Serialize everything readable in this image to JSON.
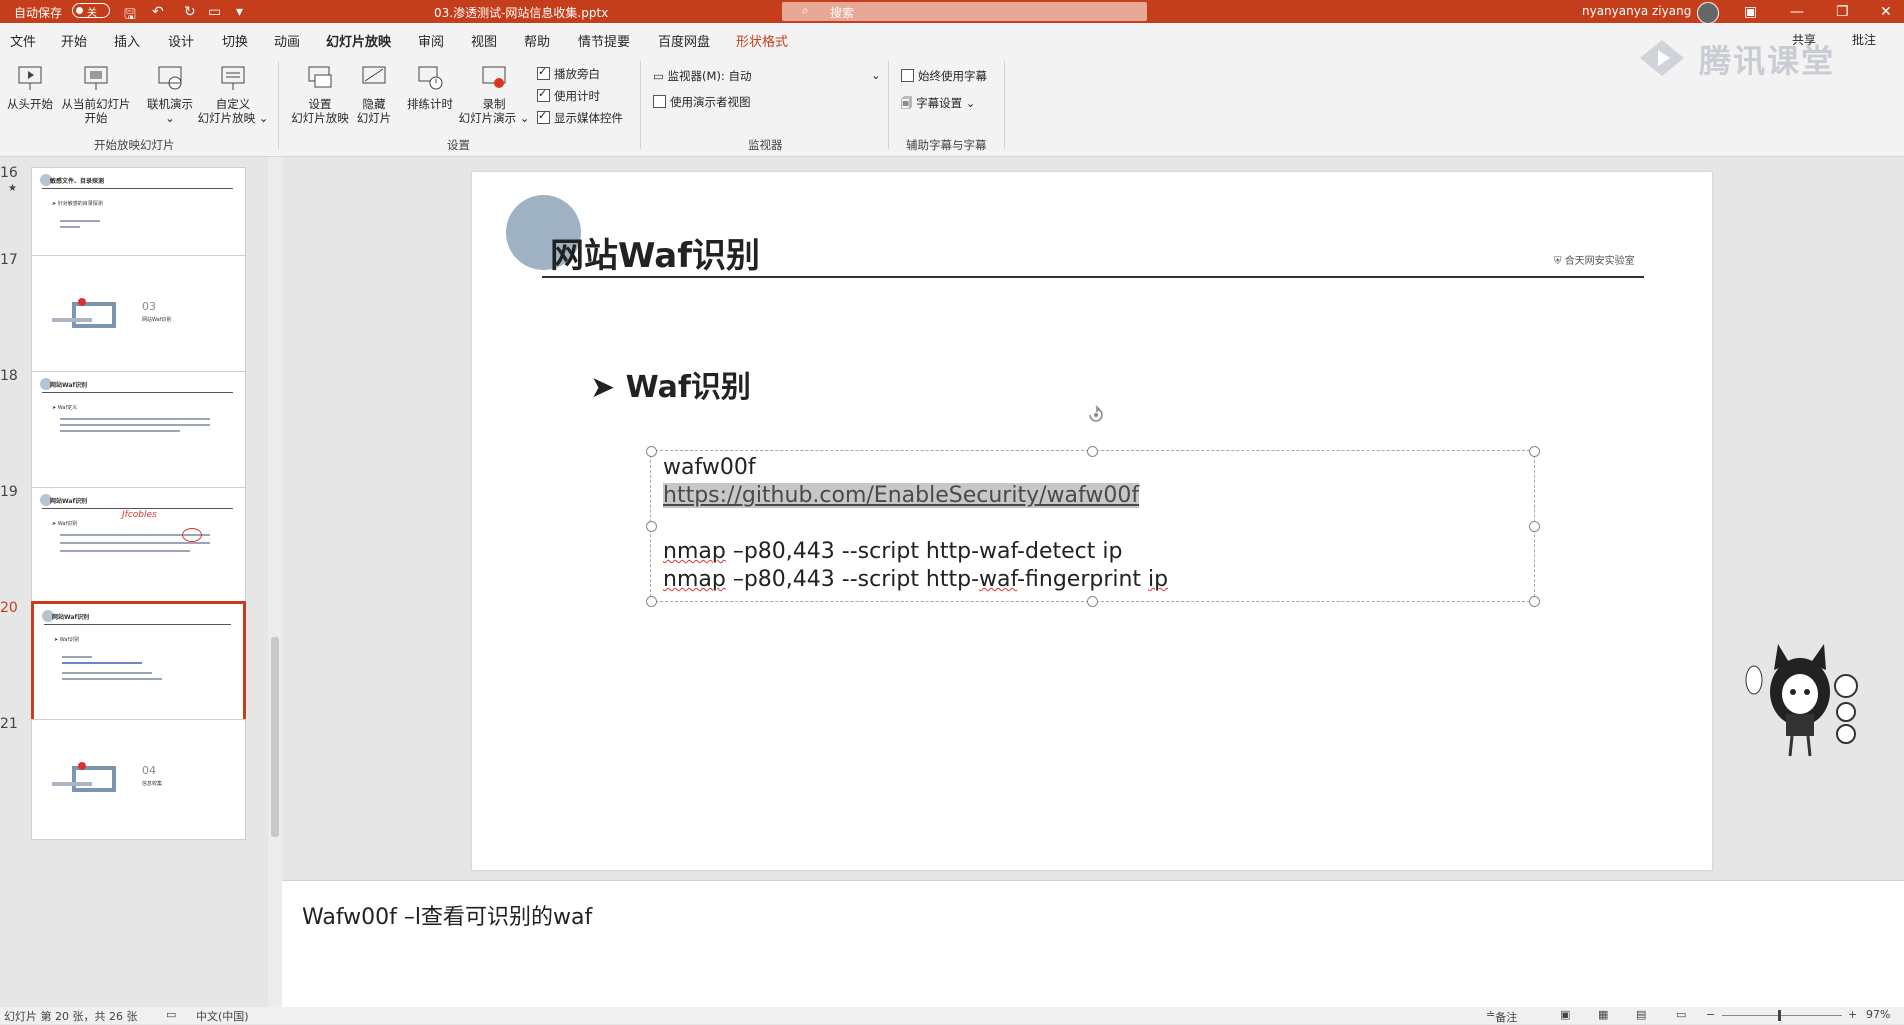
{
  "titlebar": {
    "autosave_label": "自动保存",
    "autosave_state": "关",
    "filename": "03.渗透测试-网站信息收集.pptx",
    "search_placeholder": "搜索",
    "user": "nyanyanya ziyang",
    "accent_color": "#c43e1c"
  },
  "tabs": [
    "文件",
    "开始",
    "插入",
    "设计",
    "切换",
    "动画",
    "幻灯片放映",
    "审阅",
    "视图",
    "帮助",
    "情节提要",
    "百度网盘",
    "形状格式"
  ],
  "active_tab": "幻灯片放映",
  "ribbon": {
    "start_group": {
      "from_beginning": "从头开始",
      "from_current_1": "从当前幻灯片",
      "from_current_2": "开始",
      "online": "联机演示",
      "custom_1": "自定义",
      "custom_2": "幻灯片放映",
      "label": "开始放映幻灯片"
    },
    "setup_group": {
      "setup_1": "设置",
      "setup_2": "幻灯片放映",
      "hide_1": "隐藏",
      "hide_2": "幻灯片",
      "rehearse": "排练计时",
      "record_1": "录制",
      "record_2": "幻灯片演示",
      "play_narrations": "播放旁白",
      "use_timings": "使用计时",
      "show_media": "显示媒体控件",
      "label": "设置"
    },
    "monitors_group": {
      "monitor_label": "监视器(M):",
      "monitor_value": "自动",
      "presenter_view": "使用演示者视图",
      "label": "监视器"
    },
    "captions_group": {
      "always_subtitles": "始终使用字幕",
      "subtitle_settings": "字幕设置",
      "label": "辅助字幕与字幕"
    },
    "share": "共享",
    "comments": "批注"
  },
  "watermark": "腾讯课堂",
  "thumbnails": [
    {
      "num": "16",
      "title": "敏感文件、目录探测",
      "sub": "➤ 针对敏感的目录探测"
    },
    {
      "num": "17",
      "title": "",
      "sub": "03",
      "section": "网站Waf识别"
    },
    {
      "num": "18",
      "title": "网站Waf识别",
      "sub": "➤ Waf定义"
    },
    {
      "num": "19",
      "title": "网站Waf识别",
      "sub": "➤ Waf识别",
      "annotation": "Jfcobles"
    },
    {
      "num": "20",
      "title": "网站Waf识别",
      "sub": "➤ Waf识别"
    },
    {
      "num": "21",
      "title": "",
      "sub": "04",
      "section": "信息收集"
    }
  ],
  "slide": {
    "title": "网站Waf识别",
    "logo_text": "合天网安实验室",
    "bullet": "Waf识别",
    "lines": {
      "line1": "wafw00f",
      "line2": "https://github.com/EnableSecurity/wafw00f",
      "line3_a": "nmap",
      "line3_b": " –p80,443 --script http-waf-detect ip",
      "line4_a": "nmap",
      "line4_b": " –p80,443 --script http-",
      "line4_c": "waf",
      "line4_d": "-fingerprint ",
      "line4_e": "ip"
    }
  },
  "notes": "Wafw00f –l查看可识别的waf",
  "statusbar": {
    "slide_info": "幻灯片 第 20 张，共 26 张",
    "language": "中文(中国)",
    "notes_btn": "备注",
    "zoom": "97%"
  }
}
